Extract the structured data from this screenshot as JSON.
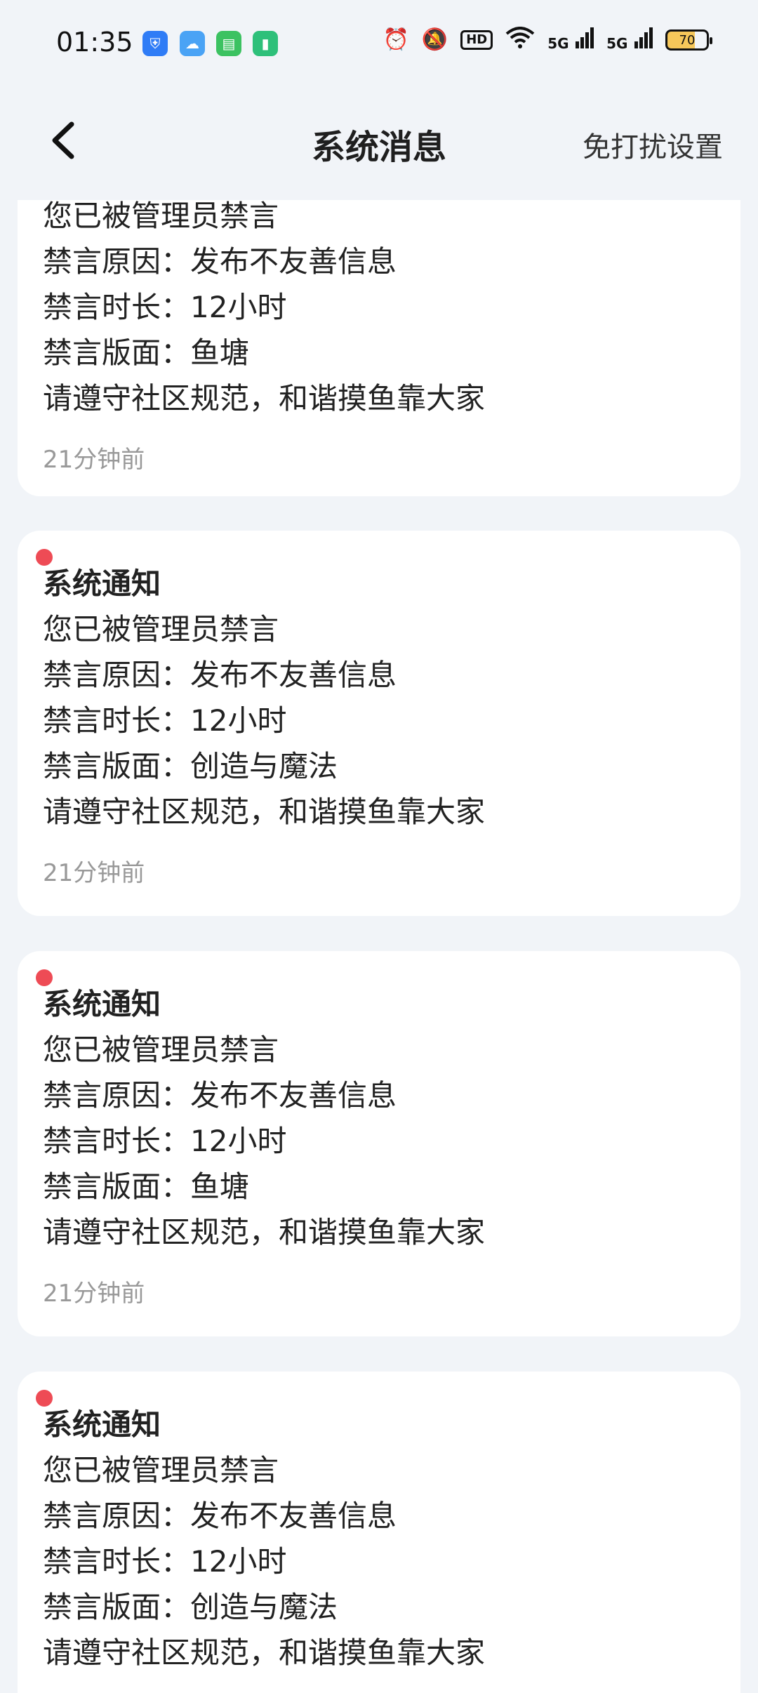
{
  "status_bar": {
    "time": "01:35",
    "app_icons": [
      "shield-app-icon",
      "weather-app-icon",
      "messages-app-icon",
      "battery-saver-app-icon"
    ],
    "hd_label": "HD",
    "signal_1": "5G",
    "signal_2": "5G",
    "battery_level": "70"
  },
  "header": {
    "title": "系统消息",
    "right_action": "免打扰设置"
  },
  "notifications": [
    {
      "title": "",
      "line1": "您已被管理员禁言",
      "line2": "禁言原因：发布不友善信息",
      "line3": "禁言时长：12小时",
      "line4": "禁言版面：鱼塘",
      "line5": "请遵守社区规范，和谐摸鱼靠大家",
      "time": "21分钟前"
    },
    {
      "title": "系统通知",
      "line1": "您已被管理员禁言",
      "line2": "禁言原因：发布不友善信息",
      "line3": "禁言时长：12小时",
      "line4": "禁言版面：创造与魔法",
      "line5": "请遵守社区规范，和谐摸鱼靠大家",
      "time": "21分钟前"
    },
    {
      "title": "系统通知",
      "line1": "您已被管理员禁言",
      "line2": "禁言原因：发布不友善信息",
      "line3": "禁言时长：12小时",
      "line4": "禁言版面：鱼塘",
      "line5": "请遵守社区规范，和谐摸鱼靠大家",
      "time": "21分钟前"
    },
    {
      "title": "系统通知",
      "line1": "您已被管理员禁言",
      "line2": "禁言原因：发布不友善信息",
      "line3": "禁言时长：12小时",
      "line4": "禁言版面：创造与魔法",
      "line5": "请遵守社区规范，和谐摸鱼靠大家",
      "time": ""
    }
  ],
  "colors": {
    "background": "#f1f4f8",
    "card": "#ffffff",
    "unread_dot": "#ee4b55",
    "timestamp": "#999999"
  }
}
